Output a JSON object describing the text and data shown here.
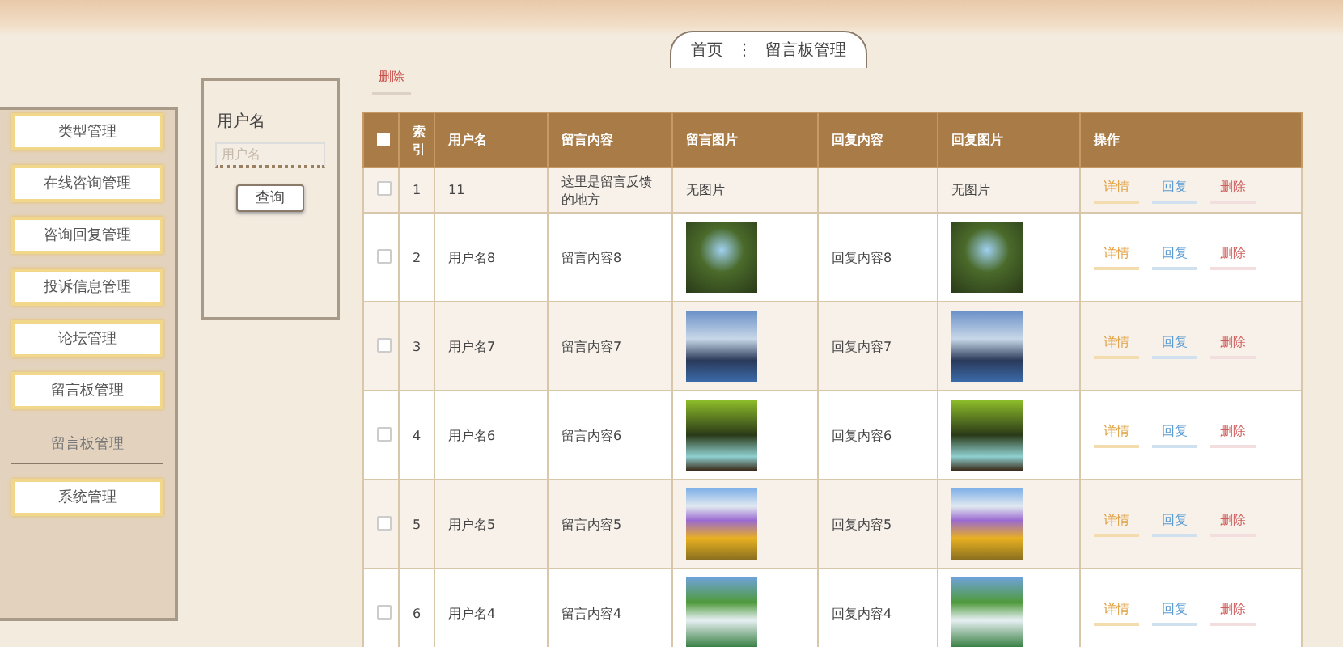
{
  "breadcrumb": {
    "items": [
      "首页",
      "留言板管理"
    ],
    "separator": "⋮"
  },
  "sidebar": {
    "items": [
      {
        "kind": "button",
        "label": "类型管理"
      },
      {
        "kind": "button",
        "label": "在线咨询管理"
      },
      {
        "kind": "button",
        "label": "咨询回复管理"
      },
      {
        "kind": "button",
        "label": "投诉信息管理"
      },
      {
        "kind": "button",
        "label": "论坛管理"
      },
      {
        "kind": "button",
        "label": "留言板管理"
      },
      {
        "kind": "heading",
        "label": "留言板管理"
      },
      {
        "kind": "button",
        "label": "系统管理"
      }
    ]
  },
  "search": {
    "label": "用户名",
    "placeholder": "用户名",
    "button": "查询"
  },
  "toolbar": {
    "delete_link": "删除"
  },
  "table": {
    "select_all": {
      "checked": false
    },
    "columns": [
      "索引",
      "用户名",
      "留言内容",
      "留言图片",
      "回复内容",
      "回复图片",
      "操作"
    ],
    "rows": [
      {
        "checked": false,
        "index": "1",
        "user": "11",
        "content": "这里是留言反馈的地方",
        "image": {
          "kind": "text",
          "text": "无图片"
        },
        "reply": "",
        "reply_image": {
          "kind": "text",
          "text": "无图片"
        },
        "actions": [
          {
            "kind": "detail",
            "label": "详情"
          },
          {
            "kind": "reply",
            "label": "回复"
          },
          {
            "kind": "delete",
            "label": "删除"
          }
        ]
      },
      {
        "checked": false,
        "index": "2",
        "user": "用户名8",
        "content": "留言内容8",
        "image": {
          "kind": "photo"
        },
        "reply": "回复内容8",
        "reply_image": {
          "kind": "photo"
        },
        "actions": [
          {
            "kind": "detail",
            "label": "详情"
          },
          {
            "kind": "reply",
            "label": "回复"
          },
          {
            "kind": "delete",
            "label": "删除"
          }
        ]
      },
      {
        "checked": false,
        "index": "3",
        "user": "用户名7",
        "content": "留言内容7",
        "image": {
          "kind": "photo"
        },
        "reply": "回复内容7",
        "reply_image": {
          "kind": "photo"
        },
        "actions": [
          {
            "kind": "detail",
            "label": "详情"
          },
          {
            "kind": "reply",
            "label": "回复"
          },
          {
            "kind": "delete",
            "label": "删除"
          }
        ]
      },
      {
        "checked": false,
        "index": "4",
        "user": "用户名6",
        "content": "留言内容6",
        "image": {
          "kind": "photo"
        },
        "reply": "回复内容6",
        "reply_image": {
          "kind": "photo"
        },
        "actions": [
          {
            "kind": "detail",
            "label": "详情"
          },
          {
            "kind": "reply",
            "label": "回复"
          },
          {
            "kind": "delete",
            "label": "删除"
          }
        ]
      },
      {
        "checked": false,
        "index": "5",
        "user": "用户名5",
        "content": "留言内容5",
        "image": {
          "kind": "photo"
        },
        "reply": "回复内容5",
        "reply_image": {
          "kind": "photo"
        },
        "actions": [
          {
            "kind": "detail",
            "label": "详情"
          },
          {
            "kind": "reply",
            "label": "回复"
          },
          {
            "kind": "delete",
            "label": "删除"
          }
        ]
      },
      {
        "checked": false,
        "index": "6",
        "user": "用户名4",
        "content": "留言内容4",
        "image": {
          "kind": "photo"
        },
        "reply": "回复内容4",
        "reply_image": {
          "kind": "photo"
        },
        "actions": [
          {
            "kind": "detail",
            "label": "详情"
          },
          {
            "kind": "reply",
            "label": "回复"
          },
          {
            "kind": "delete",
            "label": "删除"
          }
        ]
      }
    ]
  }
}
